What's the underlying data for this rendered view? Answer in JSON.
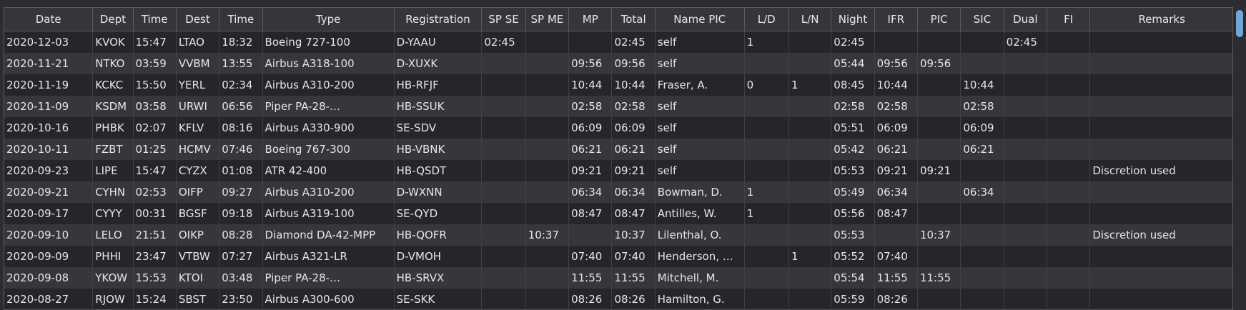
{
  "columns": [
    "Date",
    "Dept",
    "Time",
    "Dest",
    "Time",
    "Type",
    "Registration",
    "SP SE",
    "SP ME",
    "MP",
    "Total",
    "Name PIC",
    "L/D",
    "L/N",
    "Night",
    "IFR",
    "PIC",
    "SIC",
    "Dual",
    "FI",
    "Remarks"
  ],
  "rows": [
    [
      "2020-12-03",
      "KVOK",
      "15:47",
      "LTAO",
      "18:32",
      "Boeing 727-100",
      "D-YAAU",
      "02:45",
      "",
      "",
      "02:45",
      "self",
      "1",
      "",
      "02:45",
      "",
      "",
      "",
      "02:45",
      "",
      ""
    ],
    [
      "2020-11-21",
      "NTKO",
      "03:59",
      "VVBM",
      "13:55",
      "Airbus A318-100",
      "D-XUXK",
      "",
      "",
      "09:56",
      "09:56",
      "self",
      "",
      "",
      "05:44",
      "09:56",
      "09:56",
      "",
      "",
      "",
      ""
    ],
    [
      "2020-11-19",
      "KCKC",
      "15:50",
      "YERL",
      "02:34",
      "Airbus A310-200",
      "HB-RFJF",
      "",
      "",
      "10:44",
      "10:44",
      "Fraser, A.",
      "0",
      "1",
      "08:45",
      "10:44",
      "",
      "10:44",
      "",
      "",
      ""
    ],
    [
      "2020-11-09",
      "KSDM",
      "03:58",
      "URWI",
      "06:56",
      "Piper PA-28-…",
      "HB-SSUK",
      "",
      "",
      "02:58",
      "02:58",
      "self",
      "",
      "",
      "02:58",
      "02:58",
      "",
      "02:58",
      "",
      "",
      ""
    ],
    [
      "2020-10-16",
      "PHBK",
      "02:07",
      "KFLV",
      "08:16",
      "Airbus A330-900",
      "SE-SDV",
      "",
      "",
      "06:09",
      "06:09",
      "self",
      "",
      "",
      "05:51",
      "06:09",
      "",
      "06:09",
      "",
      "",
      ""
    ],
    [
      "2020-10-11",
      "FZBT",
      "01:25",
      "HCMV",
      "07:46",
      "Boeing 767-300",
      "HB-VBNK",
      "",
      "",
      "06:21",
      "06:21",
      "self",
      "",
      "",
      "05:42",
      "06:21",
      "",
      "06:21",
      "",
      "",
      ""
    ],
    [
      "2020-09-23",
      "LIPE",
      "15:47",
      "CYZX",
      "01:08",
      "ATR 42-400",
      "HB-QSDT",
      "",
      "",
      "09:21",
      "09:21",
      "self",
      "",
      "",
      "05:53",
      "09:21",
      "09:21",
      "",
      "",
      "",
      "Discretion used"
    ],
    [
      "2020-09-21",
      "CYHN",
      "02:53",
      "OIFP",
      "09:27",
      "Airbus A310-200",
      "D-WXNN",
      "",
      "",
      "06:34",
      "06:34",
      "Bowman, D.",
      "1",
      "",
      "05:49",
      "06:34",
      "",
      "06:34",
      "",
      "",
      ""
    ],
    [
      "2020-09-17",
      "CYYY",
      "00:31",
      "BGSF",
      "09:18",
      "Airbus A319-100",
      "SE-QYD",
      "",
      "",
      "08:47",
      "08:47",
      "Antilles, W.",
      "1",
      "",
      "05:56",
      "08:47",
      "",
      "",
      "",
      "",
      ""
    ],
    [
      "2020-09-10",
      "LELO",
      "21:51",
      "OIKP",
      "08:28",
      "Diamond DA-42-MPP",
      "HB-QOFR",
      "",
      "10:37",
      "",
      "10:37",
      "Lilenthal, O.",
      "",
      "",
      "05:53",
      "",
      "10:37",
      "",
      "",
      "",
      "Discretion used"
    ],
    [
      "2020-09-09",
      "PHHI",
      "23:47",
      "VTBW",
      "07:27",
      "Airbus A321-LR",
      "D-VMOH",
      "",
      "",
      "07:40",
      "07:40",
      "Henderson, …",
      "",
      "1",
      "05:52",
      "07:40",
      "",
      "",
      "",
      "",
      ""
    ],
    [
      "2020-09-08",
      "YKOW",
      "15:53",
      "KTOI",
      "03:48",
      "Piper PA-28-…",
      "HB-SRVX",
      "",
      "",
      "11:55",
      "11:55",
      "Mitchell, M.",
      "",
      "",
      "05:54",
      "11:55",
      "11:55",
      "",
      "",
      "",
      ""
    ],
    [
      "2020-08-27",
      "RJOW",
      "15:24",
      "SBST",
      "23:50",
      "Airbus A300-600",
      "SE-SKK",
      "",
      "",
      "08:26",
      "08:26",
      "Hamilton, G.",
      "",
      "",
      "05:59",
      "08:26",
      "",
      "",
      "",
      "",
      ""
    ]
  ]
}
